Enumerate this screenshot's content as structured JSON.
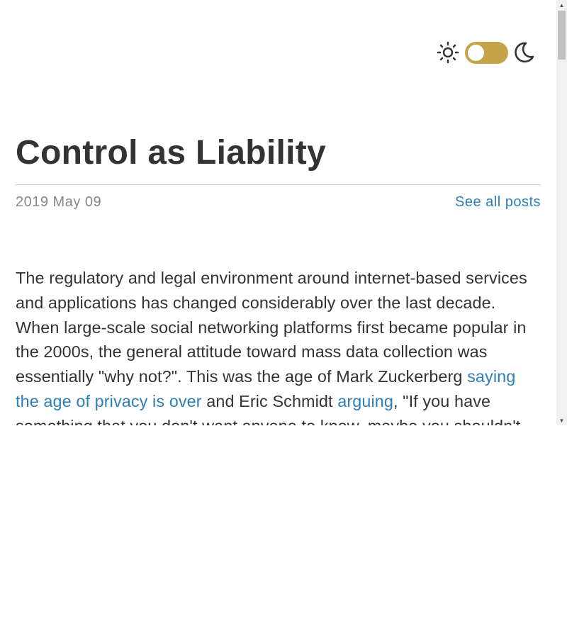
{
  "header": {
    "light_icon": "sun-icon",
    "toggle": "theme-toggle",
    "dark_icon": "moon-icon",
    "toggle_color": "#c5a349"
  },
  "post": {
    "title": "Control as Liability",
    "date": "2019 May 09",
    "all_posts_label": "See all posts",
    "body": {
      "p1_text_a": "The regulatory and legal environment around internet-based services and applications has changed considerably over the last decade. When large-scale social networking platforms first became popular in the 2000s, the general attitude toward mass data collection was essentially \"why not?\". This was the age of Mark Zuckerberg ",
      "p1_link_a": "saying the age of privacy is over",
      "p1_text_b": " and Eric Schmidt ",
      "p1_link_b": "arguing",
      "p1_text_c": ", \"If you have something that you don't want anyone to know, maybe you shouldn't be doing it in the first place.\""
    }
  },
  "colors": {
    "text": "#333333",
    "muted": "#888888",
    "link": "#2e7eb8",
    "rule": "#cccccc"
  }
}
